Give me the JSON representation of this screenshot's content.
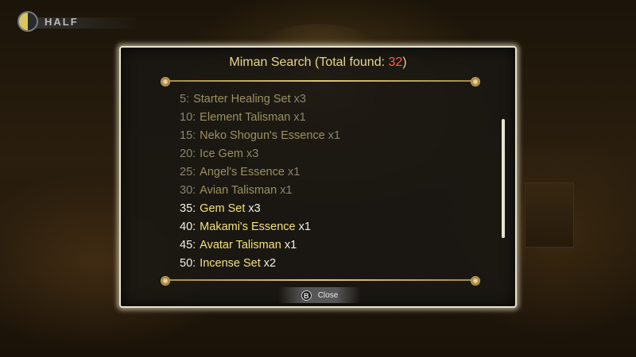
{
  "hud": {
    "moon_icon": "half-moon-icon",
    "phase_label": "HALF"
  },
  "dialog": {
    "title_prefix": "Miman Search (Total found: ",
    "total_found": "32",
    "title_suffix": ")",
    "items": [
      {
        "num": "5:",
        "name": "Starter Healing Set",
        "qty": "x3",
        "state": "collected"
      },
      {
        "num": "10:",
        "name": "Element Talisman",
        "qty": "x1",
        "state": "collected"
      },
      {
        "num": "15:",
        "name": "Neko Shogun's Essence",
        "qty": "x1",
        "state": "collected"
      },
      {
        "num": "20:",
        "name": "Ice Gem",
        "qty": "x3",
        "state": "collected"
      },
      {
        "num": "25:",
        "name": "Angel's Essence",
        "qty": "x1",
        "state": "collected"
      },
      {
        "num": "30:",
        "name": "Avian Talisman",
        "qty": "x1",
        "state": "collected"
      },
      {
        "num": "35:",
        "name": "Gem Set",
        "qty": "x3",
        "state": "available"
      },
      {
        "num": "40:",
        "name": "Makami's Essence",
        "qty": "x1",
        "state": "available"
      },
      {
        "num": "45:",
        "name": "Avatar Talisman",
        "qty": "x1",
        "state": "available"
      },
      {
        "num": "50:",
        "name": "Incense Set",
        "qty": "x2",
        "state": "available"
      }
    ],
    "close_button": {
      "icon_glyph": "B",
      "label": "Close"
    }
  },
  "colors": {
    "accent_gold": "#f3e27a",
    "count_red": "#ff5d4a",
    "dim_text": "#8a8470"
  }
}
